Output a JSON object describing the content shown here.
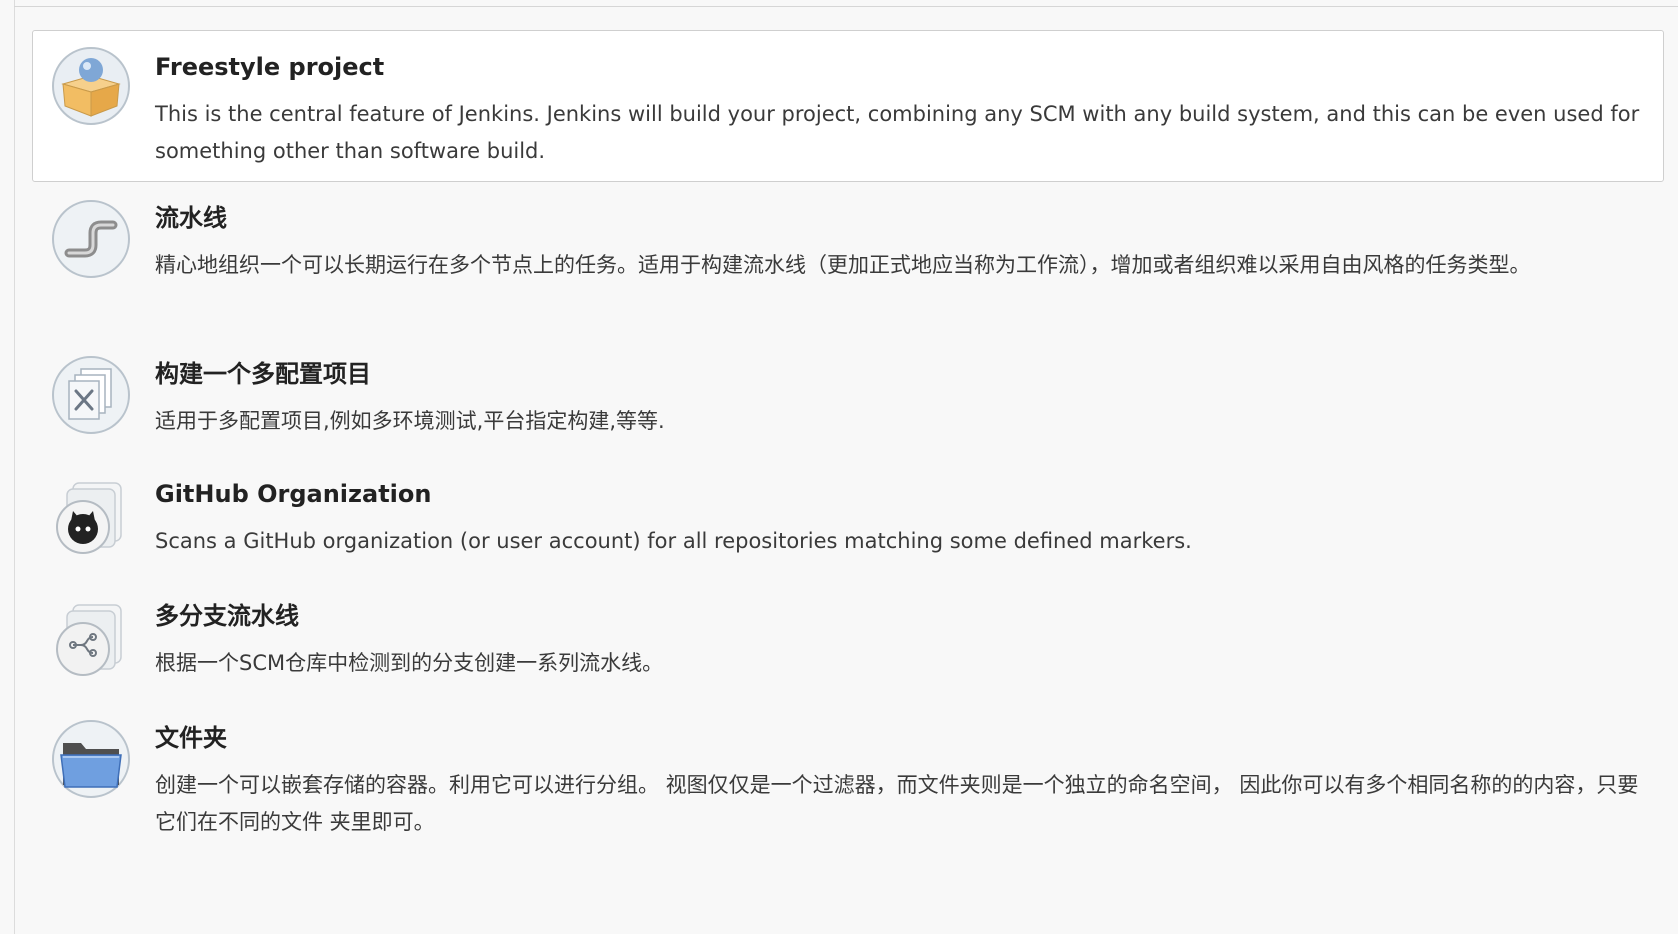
{
  "job_types": [
    {
      "label": "Freestyle project",
      "description": "This is the central feature of Jenkins. Jenkins will build your project, combining any SCM with any build system, and this can be even used for something other than software build.",
      "icon": "freestyle-box-icon",
      "selected": true
    },
    {
      "label": "流水线",
      "description": "精心地组织一个可以长期运行在多个节点上的任务。适用于构建流水线（更加正式地应当称为工作流），增加或者组织难以采用自由风格的任务类型。",
      "icon": "pipeline-icon",
      "selected": false
    },
    {
      "label": "构建一个多配置项目",
      "description": "适用于多配置项目,例如多环境测试,平台指定构建,等等.",
      "icon": "multi-config-icon",
      "selected": false
    },
    {
      "label": "GitHub Organization",
      "description": "Scans a GitHub organization (or user account) for all repositories matching some defined markers.",
      "icon": "github-organization-icon",
      "selected": false
    },
    {
      "label": "多分支流水线",
      "description": "根据一个SCM仓库中检测到的分支创建一系列流水线。",
      "icon": "multibranch-pipeline-icon",
      "selected": false
    },
    {
      "label": "文件夹",
      "description": "创建一个可以嵌套存储的容器。利用它可以进行分组。 视图仅仅是一个过滤器，而文件夹则是一个独立的命名空间， 因此你可以有多个相同名称的的内容，只要它们在不同的文件 夹里即可。",
      "icon": "folder-icon",
      "selected": false
    }
  ]
}
